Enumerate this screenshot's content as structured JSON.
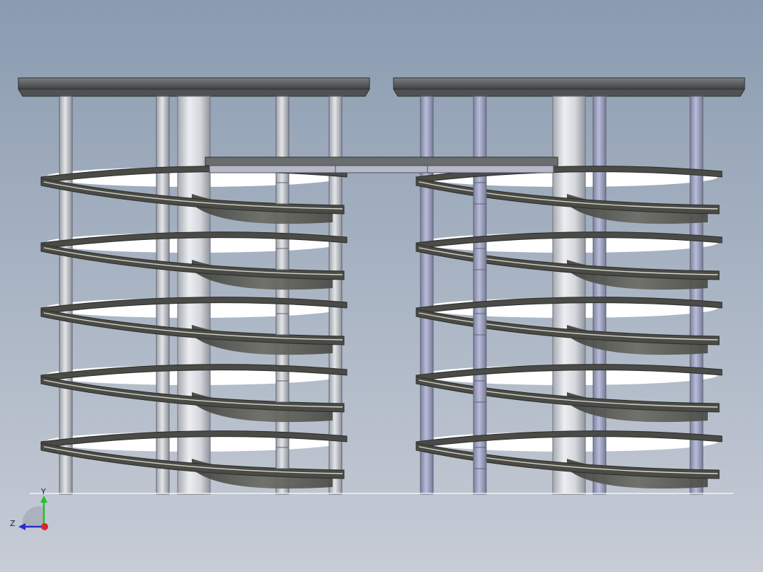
{
  "viewport": {
    "background_top": "#8a9bb0",
    "background_bottom": "#c7ccd6"
  },
  "model": {
    "colors": {
      "plate_top": "#76797a",
      "plate_front": "#4f5253",
      "column_light": "#e4e6ea",
      "column_shade": "#9a9ea6",
      "post_left": "#c9ccd2",
      "post_right": "#a7acc9",
      "spiral_band": "#4a4b46",
      "spiral_edge": "#d6d6c8",
      "spiral_web": "#5b5c55",
      "inner_white": "#ffffff",
      "ground_line": "#f4f4f4"
    },
    "assemblies": [
      "left-spiral-tower",
      "right-spiral-tower"
    ],
    "turns_per_tower": 5
  },
  "triad": {
    "y_label": "Y",
    "z_label": "Z",
    "y_color": "#22c02a",
    "z_color": "#2430c8",
    "x_color": "#d8262a"
  }
}
